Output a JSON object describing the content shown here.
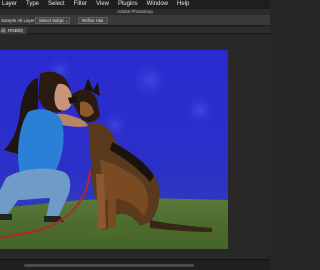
{
  "menubar": {
    "items": [
      {
        "label": "Layer"
      },
      {
        "label": "Type"
      },
      {
        "label": "Select"
      },
      {
        "label": "Filter"
      },
      {
        "label": "View"
      },
      {
        "label": "Plugins"
      },
      {
        "label": "Window"
      },
      {
        "label": "Help"
      }
    ]
  },
  "titlebar": {
    "title": "Adobe Photoshop"
  },
  "options": {
    "sample_all_layers": "Sample All Layers",
    "sample_all_layers_checked": false,
    "select_subject": "Select Subject",
    "select_subject_chevron": "⌄",
    "refine_hair": "Refine Hair"
  },
  "document": {
    "tab_label": "@, RGB/8)"
  },
  "overlay": {
    "mode": "quick mask",
    "color": "#2a2fd6"
  }
}
